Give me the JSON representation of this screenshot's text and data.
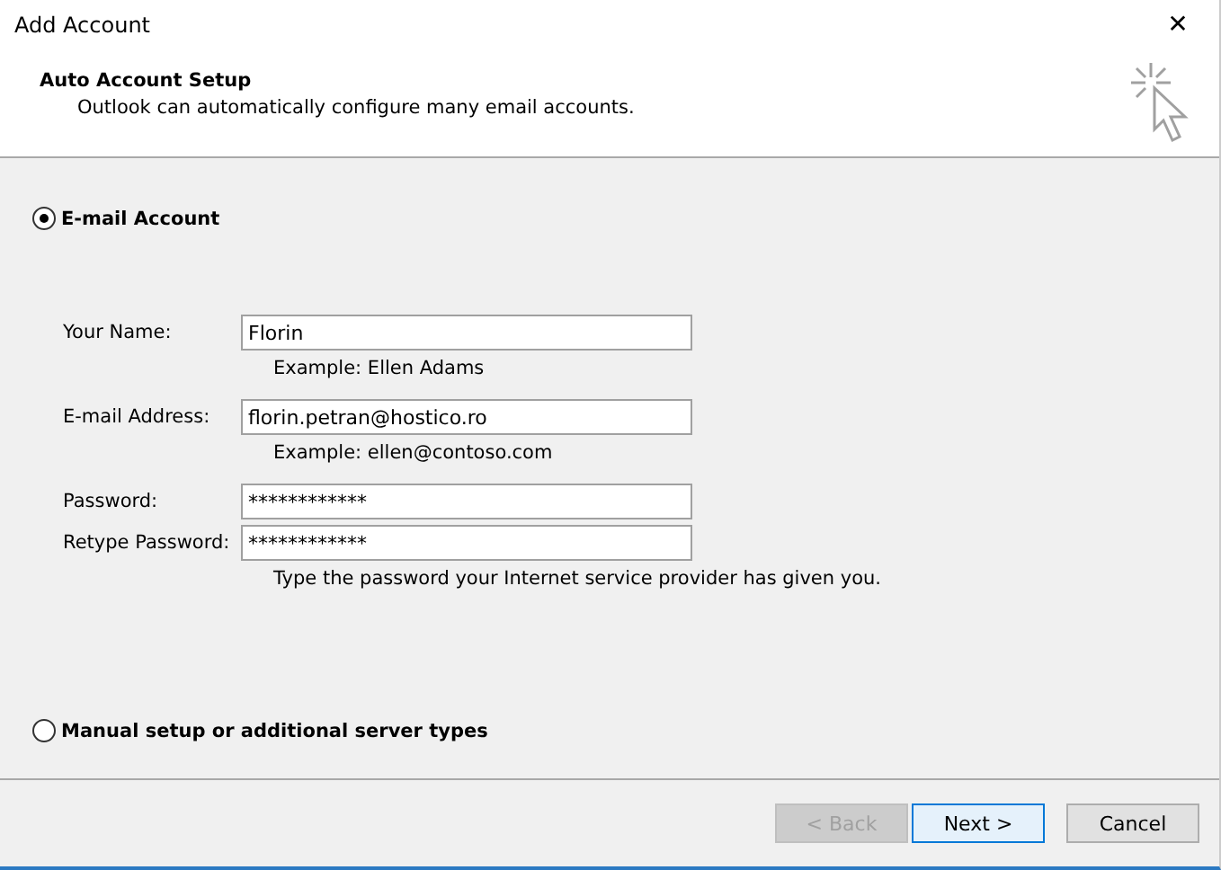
{
  "window": {
    "title": "Add Account",
    "close": "✕"
  },
  "header": {
    "title": "Auto Account Setup",
    "subtitle": "Outlook can automatically configure many email accounts."
  },
  "options": [
    {
      "label": "E-mail Account",
      "selected": true
    },
    {
      "label": "Manual setup or additional server types",
      "selected": false
    }
  ],
  "fields": [
    {
      "label": "Your Name:",
      "value": "Florin",
      "hint": "Example: Ellen Adams"
    },
    {
      "label": "E-mail Address:",
      "value": "florin.petran@hostico.ro",
      "hint": "Example: ellen@contoso.com"
    },
    {
      "label": "Password:",
      "value": "************"
    },
    {
      "label": "Retype Password:",
      "value": "************",
      "hint": "Type the password your Internet service provider has given you."
    }
  ],
  "buttons": [
    {
      "label": "< Back",
      "disabled": true,
      "default": false
    },
    {
      "label": "Next >",
      "disabled": false,
      "default": true
    },
    {
      "label": "Cancel",
      "disabled": false,
      "default": false
    }
  ]
}
